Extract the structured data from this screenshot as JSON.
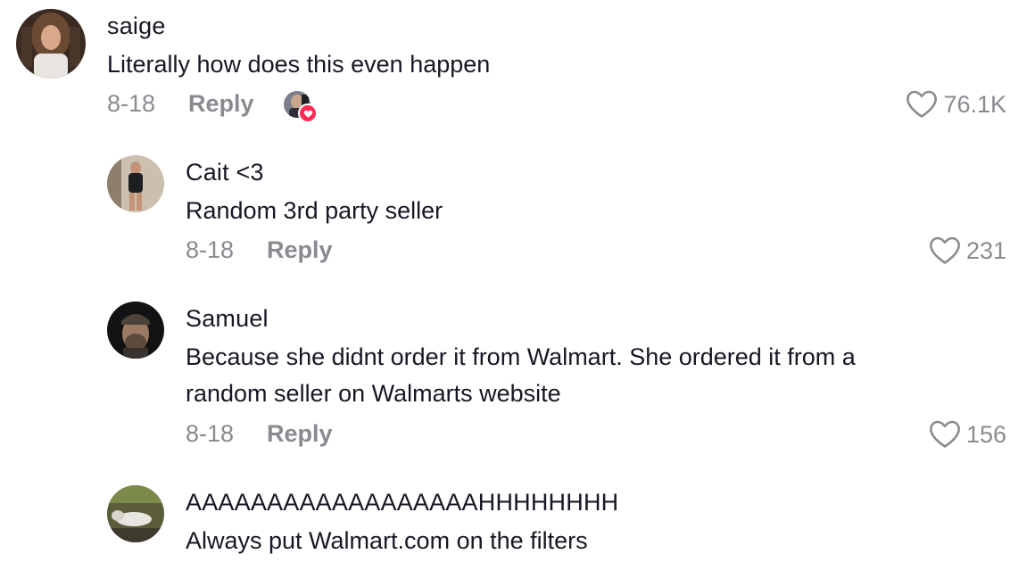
{
  "comments": [
    {
      "username": "saige",
      "text": "Literally how does this even happen",
      "date": "8-18",
      "reply_label": "Reply",
      "likes": "76.1K",
      "liked_by_creator": true,
      "avatar_icon": "user-avatar"
    },
    {
      "username": "Cait <3",
      "text": "Random 3rd party seller",
      "date": "8-18",
      "reply_label": "Reply",
      "likes": "231",
      "avatar_icon": "user-avatar"
    },
    {
      "username": "Samuel",
      "text_line1": "Because she didnt order it from Walmart. She ordered it from a",
      "text_line2": "random seller on Walmarts website",
      "date": "8-18",
      "reply_label": "Reply",
      "likes": "156",
      "avatar_icon": "user-avatar"
    },
    {
      "username": "AAAAAAAAAAAAAAAAAAHHHHHHHH",
      "text": "Always put Walmart.com on the filters",
      "avatar_icon": "user-avatar"
    }
  ],
  "colors": {
    "text": "#161823",
    "meta": "#8a8b91",
    "accent": "#fe2c55"
  },
  "icons": {
    "like": "heart-outline-icon",
    "creator_like_badge": "heart-filled-icon"
  }
}
